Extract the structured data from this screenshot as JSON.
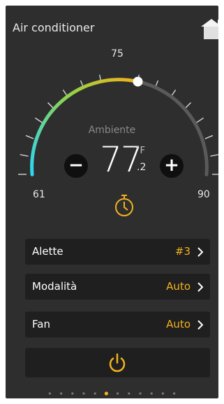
{
  "header": {
    "title": "Air conditioner",
    "home_icon": "home-icon"
  },
  "thermostat": {
    "ambient_label": "Ambiente",
    "temperature_int": "77",
    "temperature_dec": ".2",
    "unit": "°F",
    "setpoint": 75,
    "min": "61",
    "max": "90",
    "scale_label": "75",
    "decrease_label": "−",
    "increase_label": "+",
    "timer_icon": "timer-icon",
    "colors": {
      "cool": "#2fd6ef",
      "mid": "#8fd34a",
      "warm": "#f2b21c",
      "track": "#5a5a5a"
    }
  },
  "settings": {
    "rows": [
      {
        "label": "Alette",
        "value": "#3"
      },
      {
        "label": "Modalità",
        "value": "Auto"
      },
      {
        "label": "Fan",
        "value": "Auto"
      }
    ]
  },
  "power": {
    "icon": "power-icon",
    "color": "#f2b21c"
  },
  "pager": {
    "count": 12,
    "active": 5,
    "active_color": "#f2b21c"
  }
}
